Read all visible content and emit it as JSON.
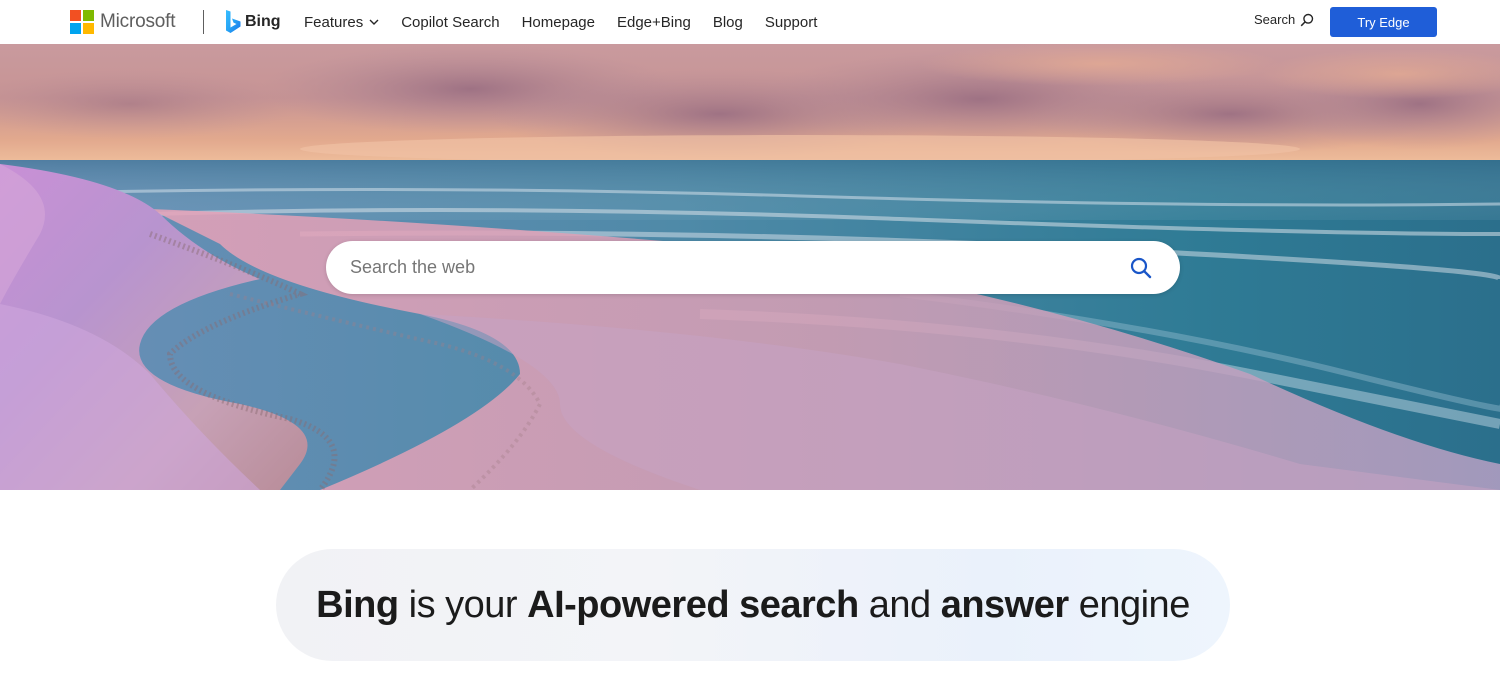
{
  "header": {
    "microsoft_label": "Microsoft",
    "bing_label": "Bing",
    "nav": [
      {
        "label": "Features",
        "has_dropdown": true
      },
      {
        "label": "Copilot Search"
      },
      {
        "label": "Homepage"
      },
      {
        "label": "Edge+Bing"
      },
      {
        "label": "Blog"
      },
      {
        "label": "Support"
      }
    ],
    "search_label": "Search",
    "try_edge_label": "Try Edge"
  },
  "hero": {
    "search_placeholder": "Search the web",
    "search_icon": "search-icon"
  },
  "tagline": {
    "parts": [
      {
        "text": "Bing",
        "bold": true
      },
      {
        "text": " is your ",
        "bold": false
      },
      {
        "text": "AI-powered search",
        "bold": true
      },
      {
        "text": " and ",
        "bold": false
      },
      {
        "text": "answer",
        "bold": true
      },
      {
        "text": " engine",
        "bold": false
      }
    ]
  },
  "colors": {
    "brand_blue": "#1f5ed8",
    "ms_red": "#f25022",
    "ms_green": "#7fba00",
    "ms_blue": "#00a4ef",
    "ms_yellow": "#ffb900",
    "search_icon_blue": "#1a56c8"
  }
}
